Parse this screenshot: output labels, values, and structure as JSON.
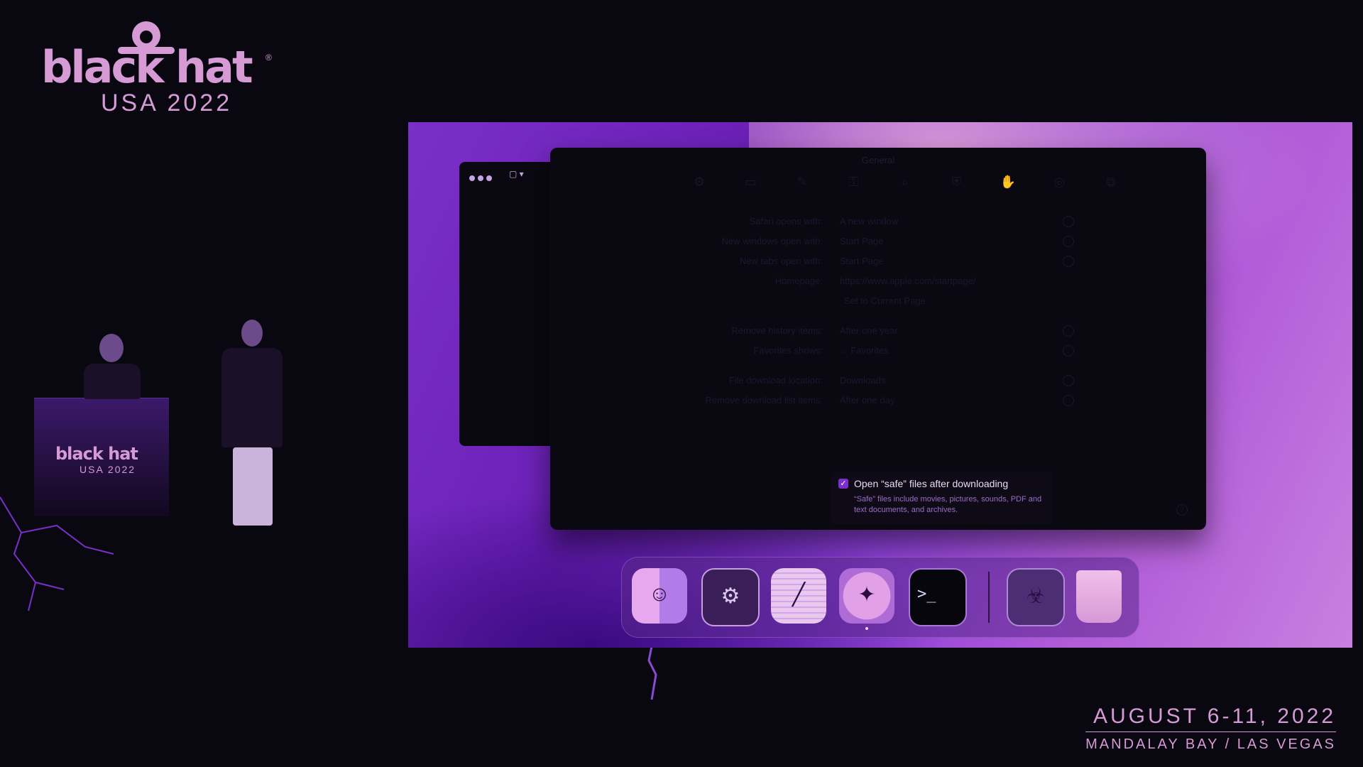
{
  "event_branding": {
    "logo_text": "black hat",
    "edition": "USA 2022",
    "registered_mark": "®",
    "dates": "AUGUST 6-11, 2022",
    "venue": "MANDALAY BAY / LAS VEGAS"
  },
  "podium": {
    "logo_text": "black hat",
    "edition": "USA 2022"
  },
  "preferences_window": {
    "title": "General",
    "toolbar": [
      {
        "label": "",
        "icon": "gear-icon"
      },
      {
        "label": "",
        "icon": "tabs-icon"
      },
      {
        "label": "",
        "icon": "autofill-icon"
      },
      {
        "label": "",
        "icon": "passwords-icon"
      },
      {
        "label": "",
        "icon": "search-icon"
      },
      {
        "label": "",
        "icon": "security-icon"
      },
      {
        "label": "",
        "icon": "privacy-icon"
      },
      {
        "label": "",
        "icon": "websites-icon"
      },
      {
        "label": "",
        "icon": "extensions-icon"
      }
    ],
    "settings": [
      {
        "label": "Safari opens with:",
        "value": "A new window"
      },
      {
        "label": "New windows open with:",
        "value": "Start Page"
      },
      {
        "label": "New tabs open with:",
        "value": "Start Page"
      },
      {
        "label": "Homepage:",
        "value": "https://www.apple.com/startpage/"
      },
      {
        "label": "",
        "value": "Set to Current Page"
      },
      {
        "label": "Remove history items:",
        "value": "After one year"
      },
      {
        "label": "Favorites shows:",
        "value": "☆ Favorites"
      },
      {
        "label": "File download location:",
        "value": "Downloads"
      },
      {
        "label": "Remove download list items:",
        "value": "After one day"
      }
    ],
    "open_safe_files": {
      "checked": true,
      "label": "Open “safe” files after downloading",
      "description": "“Safe” files include movies, pictures, sounds, PDF and text documents, and archives."
    },
    "help_glyph": "?"
  },
  "dock": {
    "apps": [
      {
        "name": "Finder",
        "icon": "finder-icon",
        "glyph": "☺"
      },
      {
        "name": "System Preferences",
        "icon": "system-preferences-icon",
        "glyph": "⚙"
      },
      {
        "name": "Script Editor",
        "icon": "script-editor-icon",
        "glyph": "╱"
      },
      {
        "name": "Safari",
        "icon": "safari-icon",
        "glyph": "✦"
      },
      {
        "name": "Terminal",
        "icon": "terminal-icon",
        "glyph": ">_"
      },
      {
        "name": "Biohazard",
        "icon": "biohazard-icon",
        "glyph": "☣"
      },
      {
        "name": "Trash",
        "icon": "trash-icon",
        "glyph": ""
      }
    ]
  },
  "colors": {
    "brand_pink": "#d69ad4",
    "desktop_purple": "#7a2fc9",
    "window_bg": "#0a0810",
    "checkbox_accent": "#7b2fd0"
  }
}
